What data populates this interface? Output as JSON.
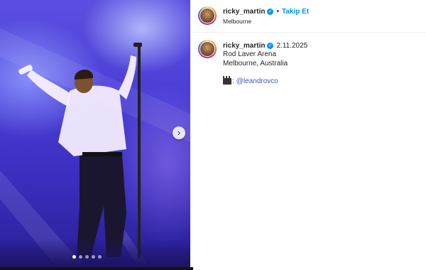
{
  "post": {
    "image": {
      "alt_icon": "concert-photo",
      "carousel_dots": 5,
      "active_dot": 0,
      "next_icon": "›"
    },
    "header": {
      "username": "ricky_martin",
      "verified_icon": "✓",
      "separator": "•",
      "follow_label": "Takip Et",
      "location": "Melbourne",
      "more_icon": "•••"
    },
    "caption": {
      "username": "ricky_martin",
      "verified_icon": "✓",
      "date": "2.11.2025",
      "lines": [
        "Rod Laver Arena",
        "Melbourne, Australia"
      ],
      "credit_colon": ":",
      "credit_mention": "@leandrovco"
    }
  },
  "colors": {
    "link_blue": "#0095f6",
    "mention_blue": "#3a5bb0",
    "stage_purple": "#4b3fd6"
  }
}
